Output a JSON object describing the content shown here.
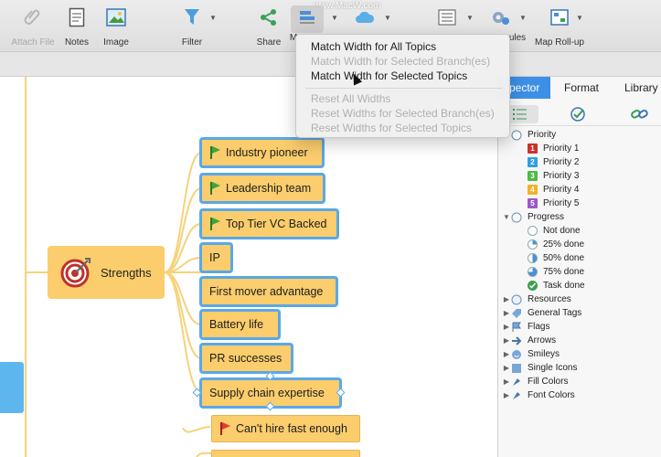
{
  "toolbar": {
    "items": [
      {
        "label": "Attach File",
        "icon": "paperclip-icon",
        "disabled": true
      },
      {
        "label": "Notes",
        "icon": "notes-icon"
      },
      {
        "label": "Image",
        "icon": "image-icon"
      },
      {
        "label": "Filter",
        "icon": "filter-icon"
      },
      {
        "label": "Share",
        "icon": "share-icon"
      },
      {
        "label": "M",
        "icon": "match-width-icon"
      },
      {
        "label": "",
        "icon": "cloud-icon"
      },
      {
        "label": "",
        "icon": "list-icon"
      },
      {
        "label": "ules",
        "icon": "rules-icon"
      },
      {
        "label": "Map Roll-up",
        "icon": "map-rollup-icon"
      }
    ],
    "watermark": "www.MacW.com"
  },
  "menu": {
    "items": [
      {
        "label": "Match Width for All Topics",
        "enabled": true
      },
      {
        "label": "Match Width for Selected Branch(es)",
        "enabled": false
      },
      {
        "label": "Match Width for Selected Topics",
        "enabled": true
      },
      {
        "label": "Reset All Widths",
        "enabled": false
      },
      {
        "label": "Reset Widths for Selected Branch(es)",
        "enabled": false
      },
      {
        "label": "Reset Widths for Selected Topics",
        "enabled": false
      }
    ]
  },
  "mindmap": {
    "central": {
      "label": "Strengths",
      "icon": "target-icon"
    },
    "topics": [
      {
        "label": "Industry pioneer",
        "flag": "green"
      },
      {
        "label": "Leadership team",
        "flag": "green"
      },
      {
        "label": "Top Tier VC Backed",
        "flag": "green"
      },
      {
        "label": "IP",
        "flag": ""
      },
      {
        "label": "First mover advantage",
        "flag": ""
      },
      {
        "label": "Battery life",
        "flag": ""
      },
      {
        "label": "PR successes",
        "flag": ""
      },
      {
        "label": "Supply chain expertise",
        "flag": ""
      },
      {
        "label": "Can't hire fast enough",
        "flag": "red"
      }
    ]
  },
  "panel": {
    "tabs": [
      "spector",
      "Format",
      "Library"
    ],
    "active_tab": "spector",
    "colors": {
      "accent": "#3d8fe5",
      "topic": "#fbcd6c"
    },
    "priority": {
      "label": "Priority",
      "items": [
        {
          "num": "1",
          "label": "Priority 1",
          "color": "#d0302a"
        },
        {
          "num": "2",
          "label": "Priority 2",
          "color": "#2f9fe0"
        },
        {
          "num": "3",
          "label": "Priority 3",
          "color": "#4fb948"
        },
        {
          "num": "4",
          "label": "Priority 4",
          "color": "#f0b429"
        },
        {
          "num": "5",
          "label": "Priority 5",
          "color": "#9b59c6"
        }
      ]
    },
    "progress": {
      "label": "Progress",
      "items": [
        {
          "label": "Not done",
          "fraction": 0
        },
        {
          "label": "25% done",
          "fraction": 0.25
        },
        {
          "label": "50% done",
          "fraction": 0.5
        },
        {
          "label": "75% done",
          "fraction": 0.75
        },
        {
          "label": "Task done",
          "fraction": 1
        }
      ]
    },
    "groups": [
      {
        "label": "Resources",
        "icon": "resources-icon"
      },
      {
        "label": "General Tags",
        "icon": "tag-icon"
      },
      {
        "label": "Flags",
        "icon": "flags-icon"
      },
      {
        "label": "Arrows",
        "icon": "arrows-icon"
      },
      {
        "label": "Smileys",
        "icon": "smileys-icon"
      },
      {
        "label": "Single Icons",
        "icon": "single-icons-icon"
      },
      {
        "label": "Fill Colors",
        "icon": "fill-colors-icon"
      },
      {
        "label": "Font Colors",
        "icon": "font-colors-icon"
      }
    ]
  }
}
